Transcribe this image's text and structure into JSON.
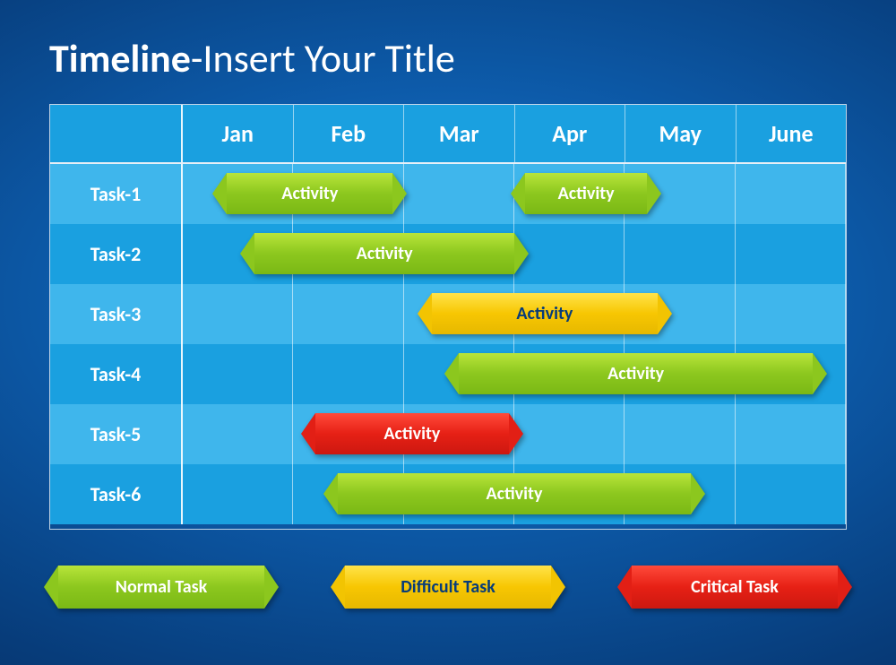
{
  "title_bold": "Timeline",
  "title_rest": "-Insert Your Title",
  "chart_data": {
    "type": "bar",
    "categories": [
      "Jan",
      "Feb",
      "Mar",
      "Apr",
      "May",
      "June"
    ],
    "series": [
      {
        "name": "Task-1",
        "bars": [
          {
            "start": 0.4,
            "end": 1.9,
            "label": "Activity",
            "kind": "green"
          },
          {
            "start": 3.1,
            "end": 4.2,
            "label": "Activity",
            "kind": "green"
          }
        ]
      },
      {
        "name": "Task-2",
        "bars": [
          {
            "start": 0.65,
            "end": 3.0,
            "label": "Activity",
            "kind": "green"
          }
        ]
      },
      {
        "name": "Task-3",
        "bars": [
          {
            "start": 2.25,
            "end": 4.3,
            "label": "Activity",
            "kind": "yellow"
          }
        ]
      },
      {
        "name": "Task-4",
        "bars": [
          {
            "start": 2.5,
            "end": 5.7,
            "label": "Activity",
            "kind": "green"
          }
        ]
      },
      {
        "name": "Task-5",
        "bars": [
          {
            "start": 1.2,
            "end": 2.95,
            "label": "Activity",
            "kind": "red"
          }
        ]
      },
      {
        "name": "Task-6",
        "bars": [
          {
            "start": 1.4,
            "end": 4.6,
            "label": "Activity",
            "kind": "green"
          }
        ]
      }
    ],
    "xlabel": "",
    "ylabel": "",
    "title": "Timeline-Insert Your Title"
  },
  "legend": [
    {
      "label": "Normal Task",
      "kind": "green"
    },
    {
      "label": "Difficult Task",
      "kind": "yellow"
    },
    {
      "label": "Critical Task",
      "kind": "red"
    }
  ],
  "colors": {
    "green": "#8cc71e",
    "yellow": "#f7c602",
    "red": "#e62015",
    "header_bg": "#1aa0e0",
    "row_alt_bg": "#3fb6ec"
  }
}
